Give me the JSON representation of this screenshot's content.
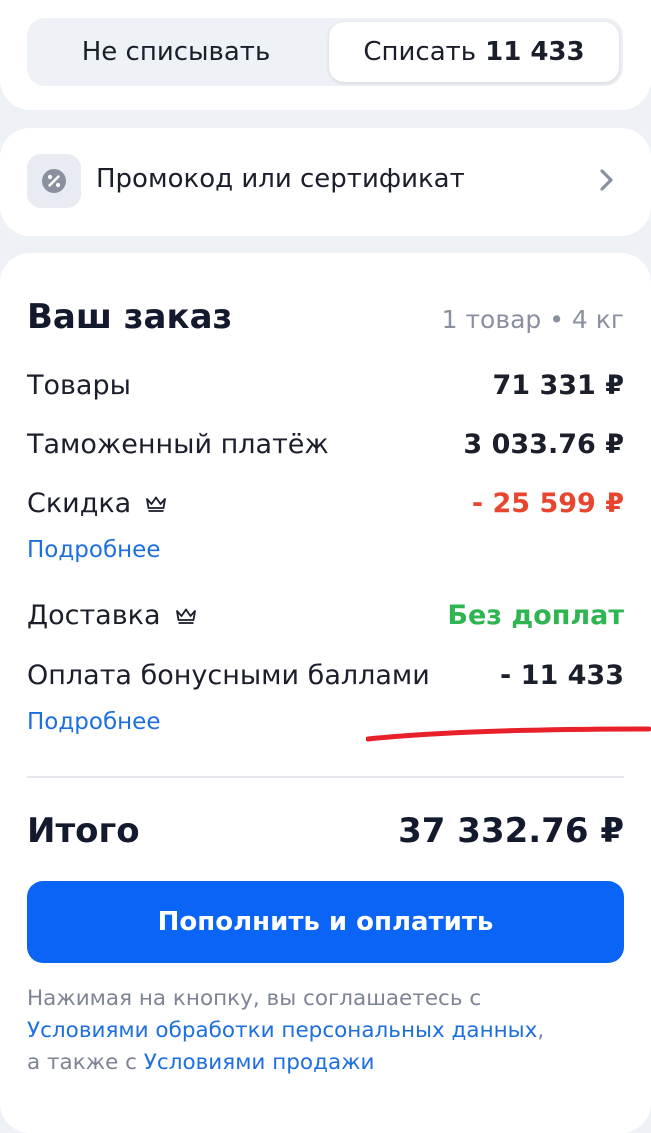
{
  "bonus_toggle": {
    "option_off": "Не списывать",
    "option_on_label": "Списать",
    "option_on_amount": "11 433"
  },
  "promo": {
    "icon": "percent-badge-icon",
    "label": "Промокод или сертификат",
    "chevron": "chevron-right-icon"
  },
  "order": {
    "title": "Ваш заказ",
    "meta": "1 товар • 4 кг",
    "rows": {
      "goods": {
        "label": "Товары",
        "value": "71 331 ₽"
      },
      "customs": {
        "label": "Таможенный платёж",
        "value": "3 033.76 ₽"
      },
      "discount": {
        "label": "Скидка",
        "value": "- 25 599 ₽",
        "link": "Подробнее"
      },
      "delivery": {
        "label": "Доставка",
        "value": "Без доплат"
      },
      "bonus": {
        "label": "Оплата бонусными баллами",
        "value": "- 11 433",
        "link": "Подробнее"
      }
    },
    "total_label": "Итого",
    "total_value": "37 332.76 ₽",
    "pay_button": "Пополнить и оплатить",
    "legal": {
      "prefix": "Нажимая на кнопку, вы соглашаетесь с",
      "link1": "Условиями обработки персональных данных",
      "comma": ",",
      "middle": "а также с",
      "link2": "Условиями продажи"
    }
  },
  "colors": {
    "accent": "#0a64f5",
    "link": "#1d6fe0",
    "discount": "#e8452f",
    "success": "#2fb552",
    "annotation": "#e8202a"
  }
}
